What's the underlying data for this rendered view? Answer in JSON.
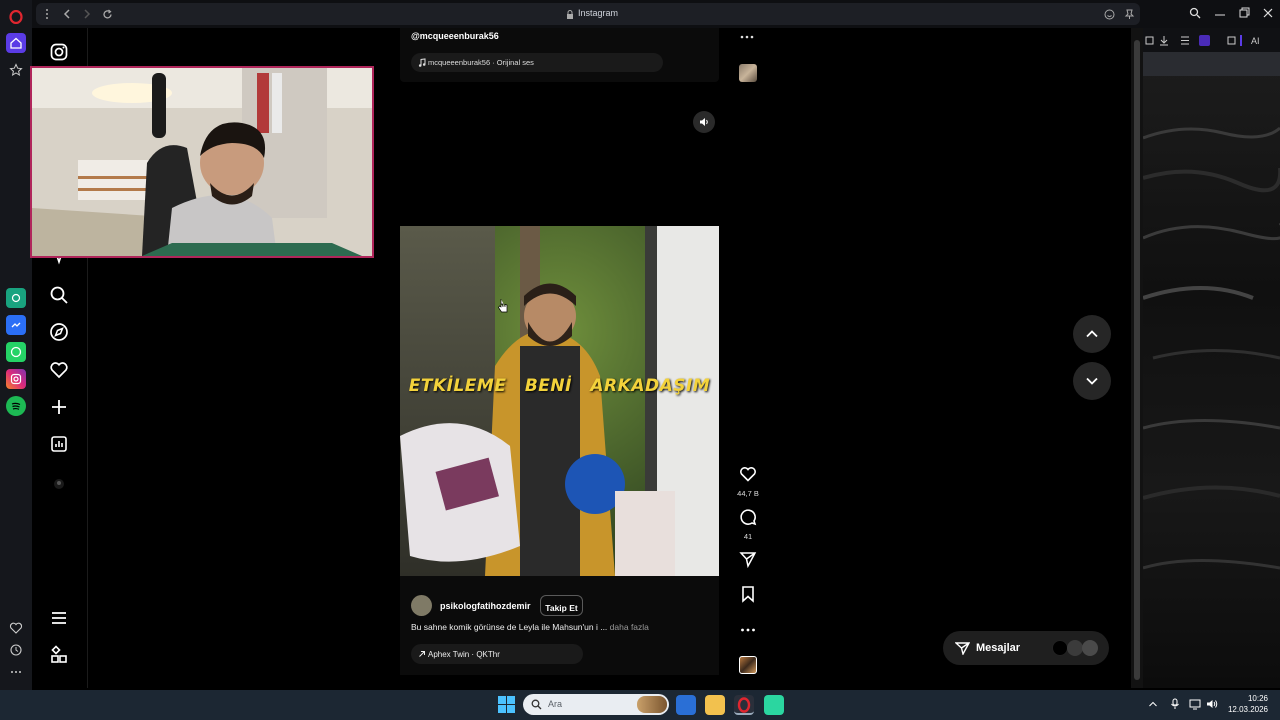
{
  "browser": {
    "tab_title": "Instagram",
    "accent": "#e0262f"
  },
  "opera_rail": {
    "items": [
      "opera-logo",
      "home-icon",
      "star-icon",
      "chatgpt-icon",
      "messenger-icon",
      "whatsapp-icon",
      "instagram-icon",
      "spotify-icon",
      "heart-icon",
      "history-icon",
      "more-icon"
    ]
  },
  "ig_sidebar": {
    "icons": [
      "instagram-logo",
      "home",
      "search",
      "explore",
      "notifications",
      "create",
      "dashboard",
      "profile",
      "menu",
      "apps"
    ]
  },
  "prev_reel": {
    "username": "@mcqueeenburak56",
    "audio": "mcqueeenburak56 · Orijinal ses"
  },
  "reel": {
    "overlay_caption": "ETKİLEME BENİ ARKADAŞIM",
    "username": "psikologfatihozdemir",
    "follow_label": "Takip Et",
    "caption": "Bu sahne komik görünse de Leyla ile Mahsun'un i ...",
    "caption_more": "daha fazla",
    "audio": "Aphex Twin · QKThr",
    "likes": "44,7 B",
    "comments": "41"
  },
  "messages": {
    "label": "Mesajlar"
  },
  "taskbar": {
    "search_placeholder": "Ara",
    "time": "10:26",
    "date": "12.03.2026"
  }
}
